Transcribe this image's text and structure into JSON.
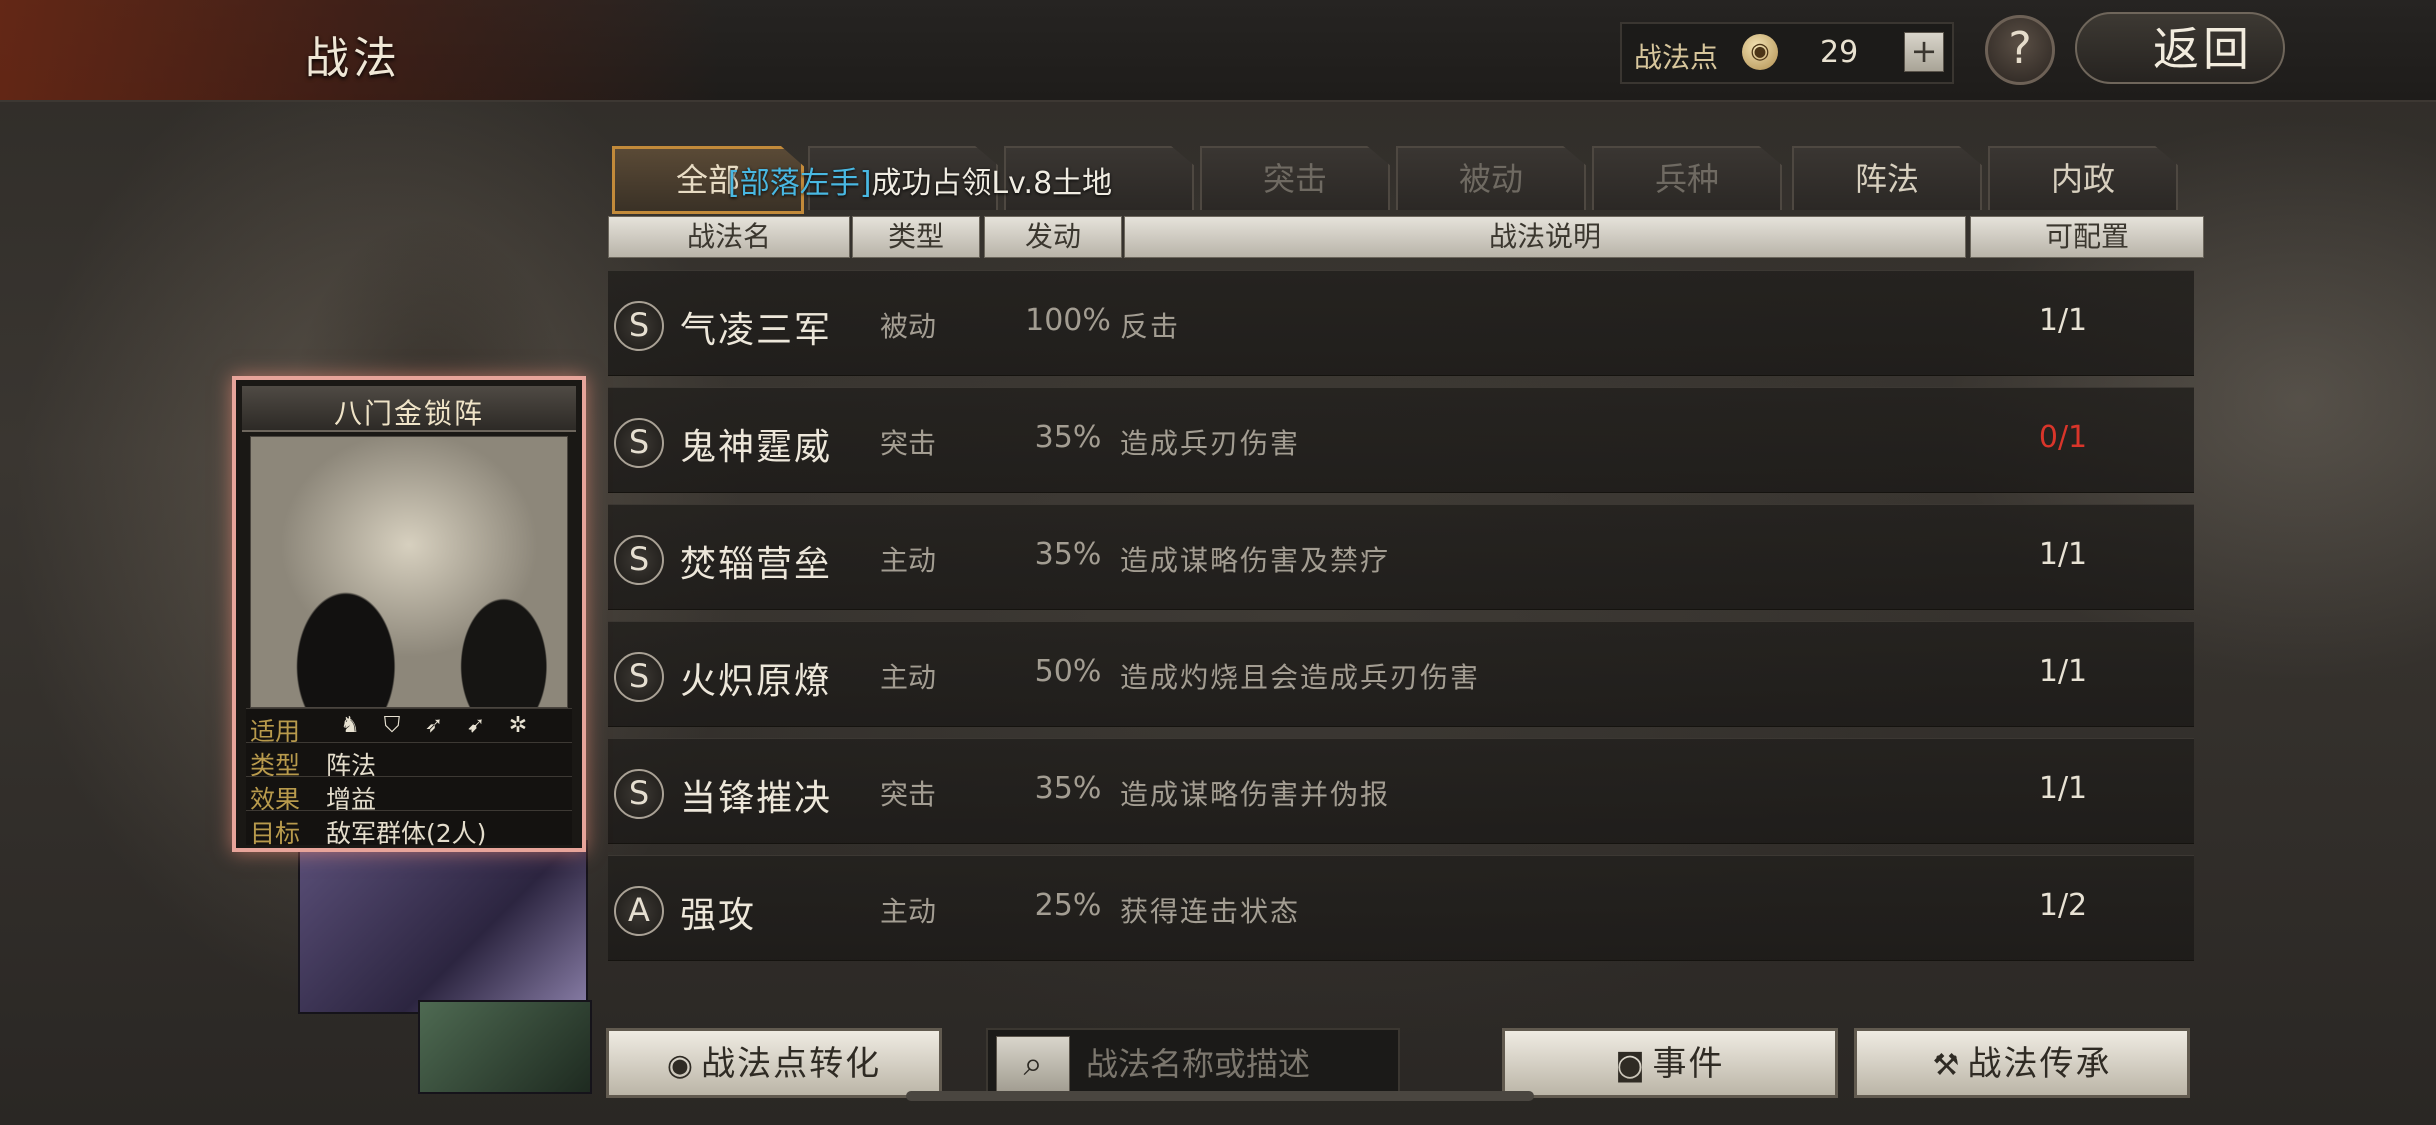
{
  "header": {
    "title": "战法",
    "points_label": "战法点",
    "points_value": "29",
    "add_label": "+",
    "help_label": "?",
    "back_label": "返回"
  },
  "tabs": [
    {
      "label": "全部",
      "state": "active"
    },
    {
      "label": "",
      "state": "hidden"
    },
    {
      "label": "",
      "state": "hidden"
    },
    {
      "label": "突击",
      "state": "dim"
    },
    {
      "label": "被动",
      "state": "dim"
    },
    {
      "label": "兵种",
      "state": "dim"
    },
    {
      "label": "阵法",
      "state": "on"
    },
    {
      "label": "内政",
      "state": "on"
    }
  ],
  "tooltip": {
    "highlight": "[部落左手]",
    "text": "成功占领Lv.8土地"
  },
  "columns": {
    "name": "战法名",
    "type": "类型",
    "rate": "发动",
    "desc": "战法说明",
    "slots": "可配置"
  },
  "skills": [
    {
      "grade": "S",
      "name": "气凌三军",
      "type": "被动",
      "rate": "100%",
      "desc": "反击",
      "slots": "1/1"
    },
    {
      "grade": "S",
      "name": "鬼神霆威",
      "type": "突击",
      "rate": "35%",
      "desc": "造成兵刃伤害",
      "slots": "0/1"
    },
    {
      "grade": "S",
      "name": "焚辎营垒",
      "type": "主动",
      "rate": "35%",
      "desc": "造成谋略伤害及禁疗",
      "slots": "1/1"
    },
    {
      "grade": "S",
      "name": "火炽原燎",
      "type": "主动",
      "rate": "50%",
      "desc": "造成灼烧且会造成兵刃伤害",
      "slots": "1/1"
    },
    {
      "grade": "S",
      "name": "当锋摧决",
      "type": "突击",
      "rate": "35%",
      "desc": "造成谋略伤害并伪报",
      "slots": "1/1"
    },
    {
      "grade": "A",
      "name": "强攻",
      "type": "主动",
      "rate": "25%",
      "desc": "获得连击状态",
      "slots": "1/2"
    }
  ],
  "card": {
    "title": "八门金锁阵",
    "apply_label": "适用",
    "type_label": "类型",
    "type_value": "阵法",
    "effect_label": "效果",
    "effect_value": "增益",
    "target_label": "目标",
    "target_value": "敌军群体(2人)",
    "unit_icons": [
      "cavalry-icon",
      "shield-icon",
      "bow-icon",
      "spear-icon",
      "wheel-icon"
    ]
  },
  "footer": {
    "convert_label": "战法点转化",
    "search_placeholder": "战法名称或描述",
    "event_label": "事件",
    "inherit_label": "战法传承"
  },
  "colors": {
    "accent_gold": "#c28a3a",
    "highlight_blue": "#49b8e2",
    "warning_red": "#d9352a",
    "card_border": "#e7a49a"
  }
}
